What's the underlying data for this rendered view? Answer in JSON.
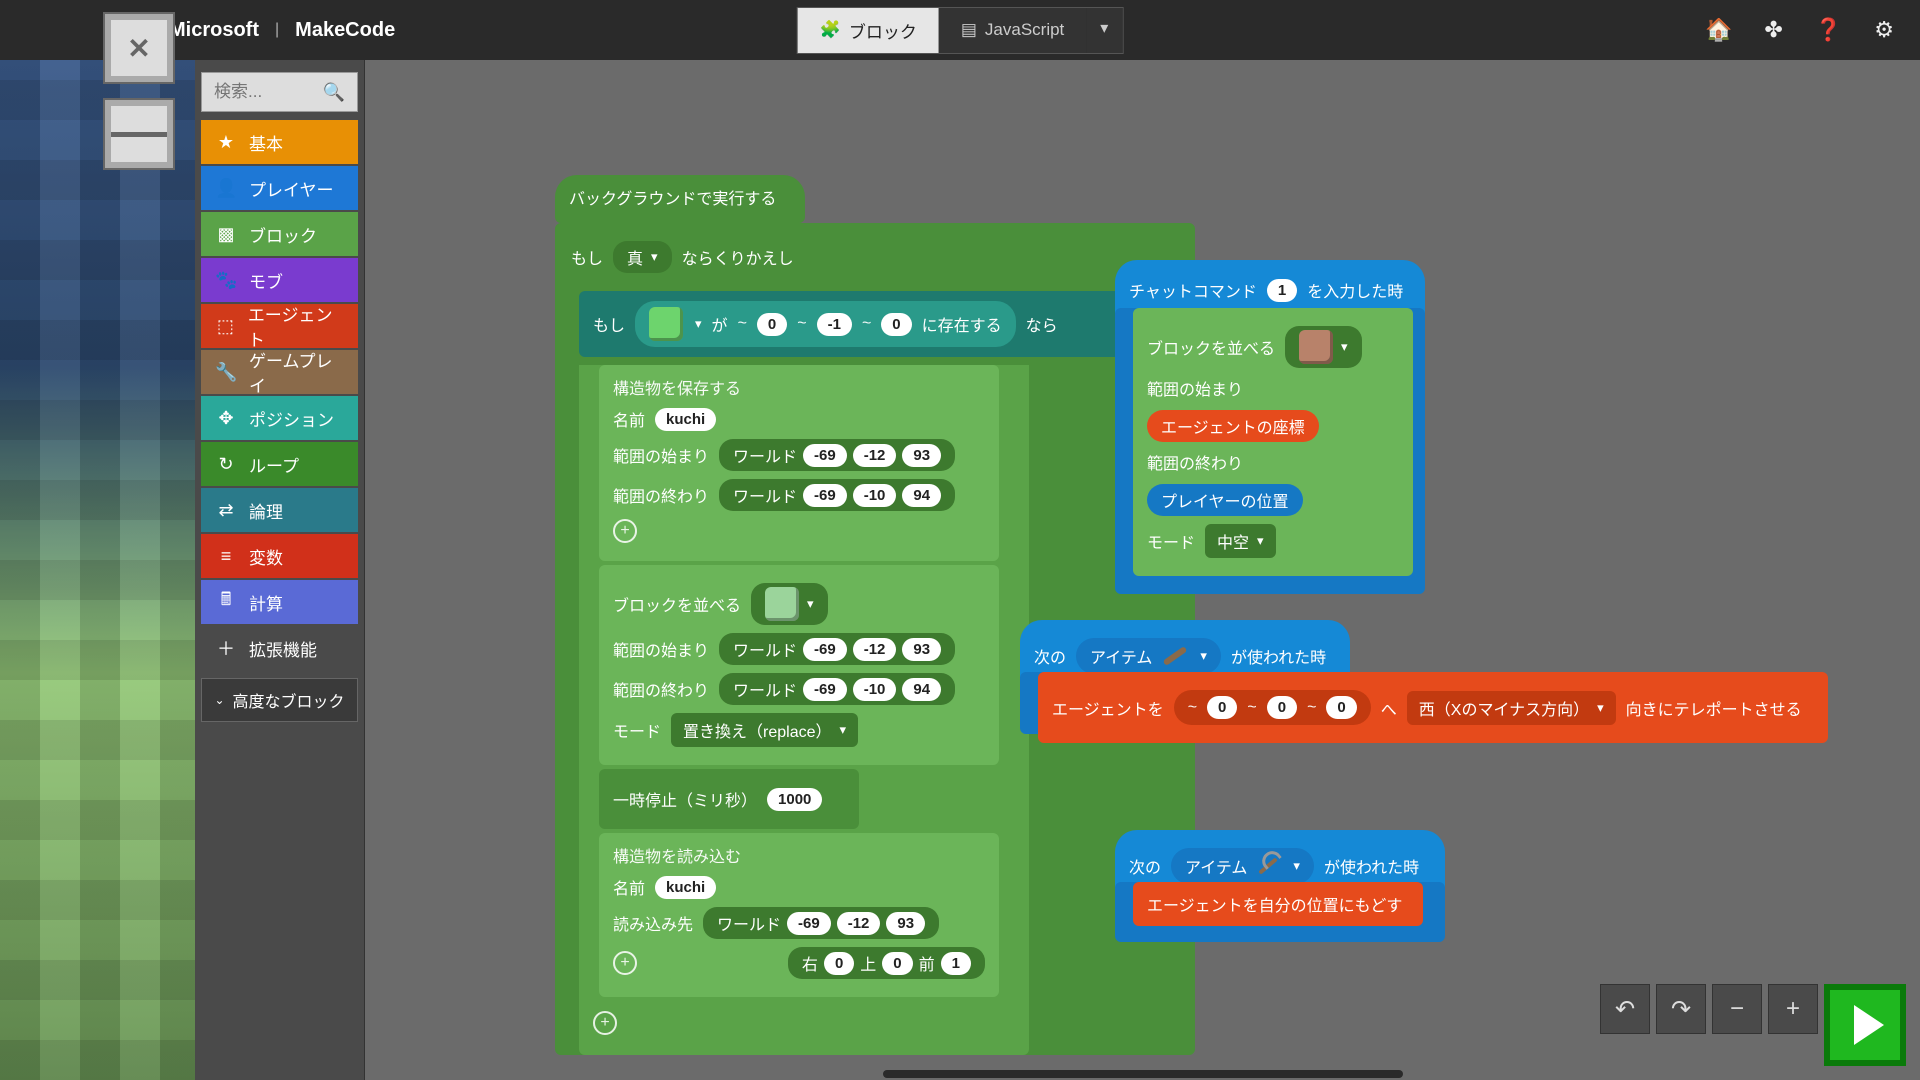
{
  "header": {
    "brand1": "Microsoft",
    "brand2": "MakeCode",
    "tab_blocks": "ブロック",
    "tab_js": "JavaScript"
  },
  "search": {
    "placeholder": "検索..."
  },
  "categories": [
    {
      "label": "基本",
      "color": "#e89005",
      "icon": "★"
    },
    {
      "label": "プレイヤー",
      "color": "#1e78d6",
      "icon": "👤"
    },
    {
      "label": "ブロック",
      "color": "#5aa348",
      "icon": "▩"
    },
    {
      "label": "モブ",
      "color": "#7a3bcf",
      "icon": "🐾"
    },
    {
      "label": "エージェント",
      "color": "#d13a1a",
      "icon": "⬚"
    },
    {
      "label": "ゲームプレイ",
      "color": "#8a6a4a",
      "icon": "🔧"
    },
    {
      "label": "ポジション",
      "color": "#2aa89a",
      "icon": "✥"
    },
    {
      "label": "ループ",
      "color": "#3a8a2a",
      "icon": "↻"
    },
    {
      "label": "論理",
      "color": "#2a7a8a",
      "icon": "⇄"
    },
    {
      "label": "変数",
      "color": "#d1301a",
      "icon": "≡"
    },
    {
      "label": "計算",
      "color": "#5a6ad6",
      "icon": "🖩"
    },
    {
      "label": "拡張機能",
      "color": "#4a4a4a",
      "icon": "＋"
    }
  ],
  "advanced": "高度なブロック",
  "main": {
    "runbg": "バックグラウンドで実行する",
    "while_l": "もし",
    "while_cond": "真",
    "while_r": "ならくりかえし",
    "if_l": "もし",
    "if_m": "が",
    "if_exists": "に存在する",
    "if_then": "なら",
    "tilde": "~",
    "xyz1": [
      "0",
      "-1",
      "0"
    ],
    "save_title": "構造物を保存する",
    "name_l": "名前",
    "name_v": "kuchi",
    "range_from": "範囲の始まり",
    "range_to": "範囲の終わり",
    "world": "ワールド",
    "from1": [
      "-69",
      "-12",
      "93"
    ],
    "to1": [
      "-69",
      "-10",
      "94"
    ],
    "fill_title": "ブロックを並べる",
    "from2": [
      "-69",
      "-12",
      "93"
    ],
    "to2": [
      "-69",
      "-10",
      "94"
    ],
    "mode_l": "モード",
    "mode_v": "置き換え（replace）",
    "pause_l": "一時停止（ミリ秒）",
    "pause_v": "1000",
    "load_title": "構造物を読み込む",
    "name2_v": "kuchi",
    "load_to": "読み込み先",
    "from3": [
      "-69",
      "-12",
      "93"
    ],
    "rot_r": "右",
    "rot_u": "上",
    "rot_f": "前",
    "rot_vals": [
      "0",
      "0",
      "1"
    ]
  },
  "chat": {
    "prefix": "チャットコマンド",
    "cmd": "1",
    "suffix": "を入力した時",
    "fill": "ブロックを並べる",
    "from_l": "範囲の始まり",
    "from_v": "エージェントの座標",
    "to_l": "範囲の終わり",
    "to_v": "プレイヤーの位置",
    "mode_l": "モード",
    "mode_v": "中空"
  },
  "item1": {
    "prefix": "次の",
    "mid": "アイテム",
    "suffix": "が使われた時",
    "tp_l": "エージェントを",
    "arrow": "へ",
    "dir": "西（Xのマイナス方向）",
    "tp_r": "向きにテレポートさせる",
    "c": [
      "0",
      "0",
      "0"
    ]
  },
  "item2": {
    "prefix": "次の",
    "mid": "アイテム",
    "suffix": "が使われた時",
    "body": "エージェントを自分の位置にもどす"
  }
}
